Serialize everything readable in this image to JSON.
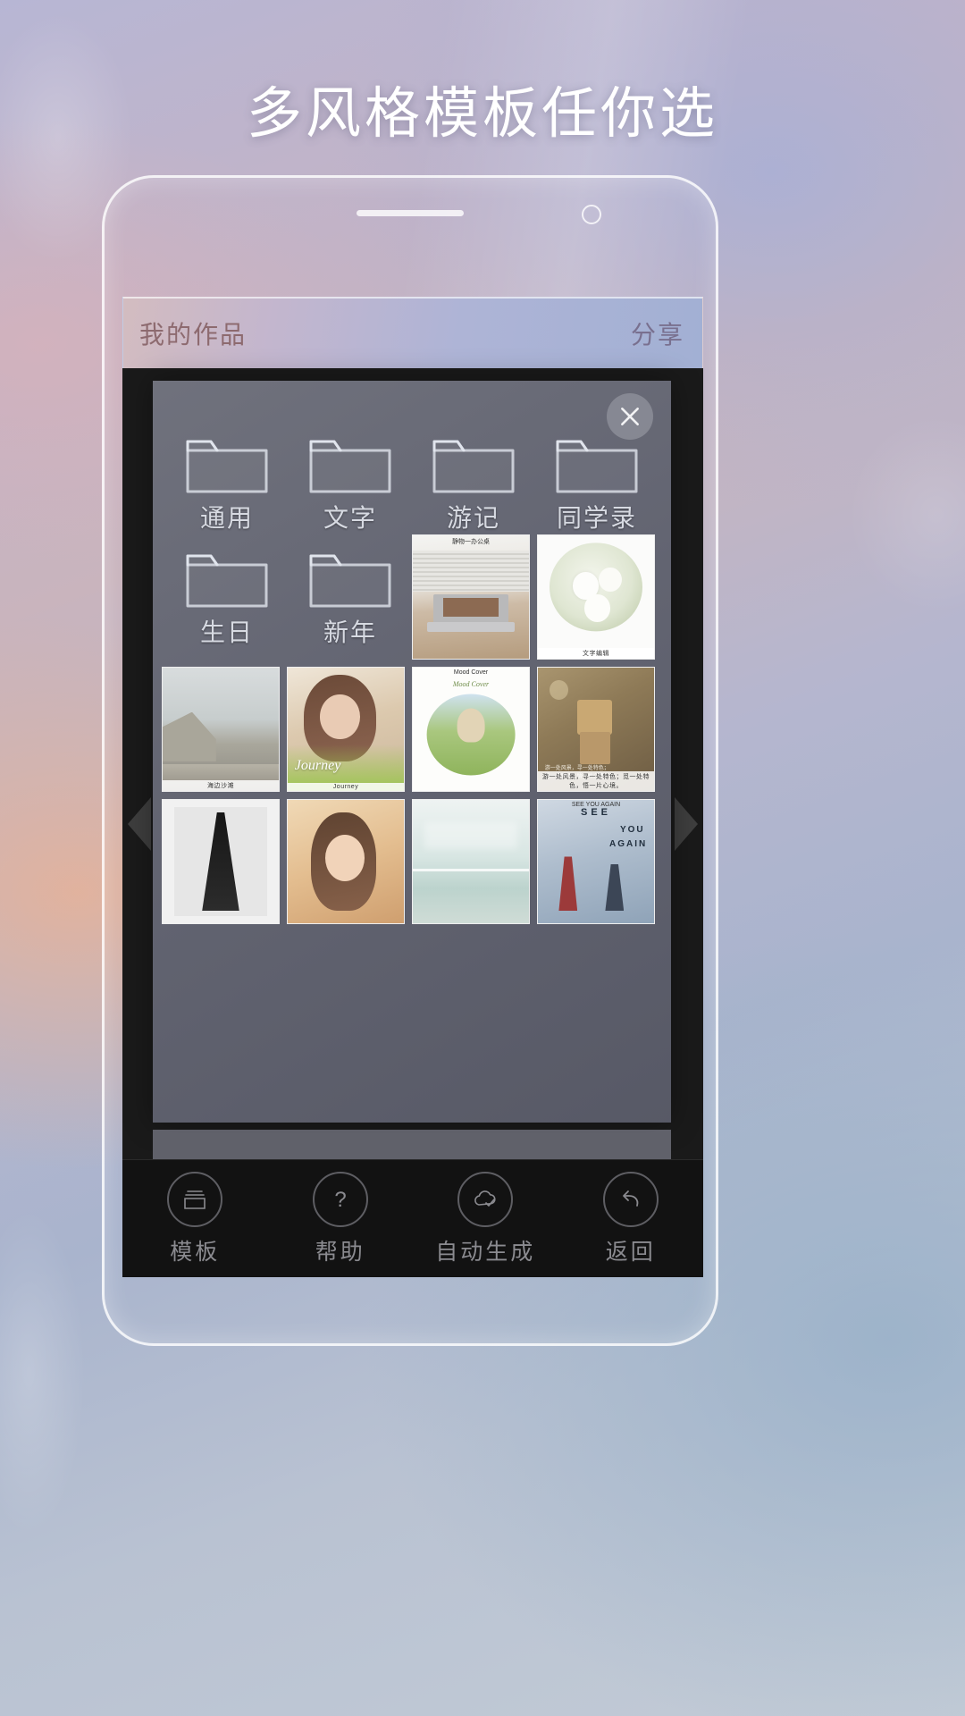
{
  "headline": "多风格模板任你选",
  "colors": {
    "headline_text": "#ffffff",
    "appbar_title": "#8d6a6f",
    "appbar_action": "#79708f",
    "folder_label": "#d7dae2",
    "nav_label": "#8b8b90",
    "modal_bg": "#6a6c78",
    "screen_bg": "#1a1a1a"
  },
  "appbar": {
    "title": "我的作品",
    "action": "分享"
  },
  "modal": {
    "close_icon": "close-icon",
    "folders": [
      {
        "label": "通用",
        "icon": "folder-icon"
      },
      {
        "label": "文字",
        "icon": "folder-icon"
      },
      {
        "label": "游记",
        "icon": "folder-icon"
      },
      {
        "label": "同学录",
        "icon": "folder-icon"
      },
      {
        "label": "生日",
        "icon": "folder-icon"
      },
      {
        "label": "新年",
        "icon": "folder-icon"
      }
    ],
    "templates": [
      {
        "id": "t-office",
        "caption_top": "静物一办公桌",
        "caption": "",
        "kind": "office-desk"
      },
      {
        "id": "t-roses",
        "caption_top": "",
        "caption": "文字编辑",
        "kind": "white-roses"
      },
      {
        "id": "t-cliff",
        "caption_top": "",
        "caption": "海边沙滩",
        "kind": "coast-cliff"
      },
      {
        "id": "t-journey",
        "caption_top": "",
        "caption": "Journey",
        "kind": "portrait-journey"
      },
      {
        "id": "t-mood",
        "caption_top": "Mood Cover",
        "caption": "",
        "kind": "sunflower-girl"
      },
      {
        "id": "t-danbo",
        "caption_top": "",
        "caption": "游一处风景，寻一处特色；觅一处特色，悟一片心境。",
        "kind": "danbo-toy"
      },
      {
        "id": "t-dress",
        "caption_top": "",
        "caption": "",
        "kind": "black-dress"
      },
      {
        "id": "t-girl",
        "caption_top": "",
        "caption": "",
        "kind": "girl-warm"
      },
      {
        "id": "t-sea",
        "caption_top": "",
        "caption": "",
        "kind": "sea-pale"
      },
      {
        "id": "t-seeyou",
        "caption_top": "SEE YOU AGAIN",
        "caption": "",
        "kind": "see-you-again"
      }
    ]
  },
  "bottom_nav": [
    {
      "label": "模板",
      "icon": "template-cards-icon"
    },
    {
      "label": "帮助",
      "icon": "question-mark-icon"
    },
    {
      "label": "自动生成",
      "icon": "cloud-check-icon"
    },
    {
      "label": "返回",
      "icon": "undo-arrow-icon"
    }
  ]
}
